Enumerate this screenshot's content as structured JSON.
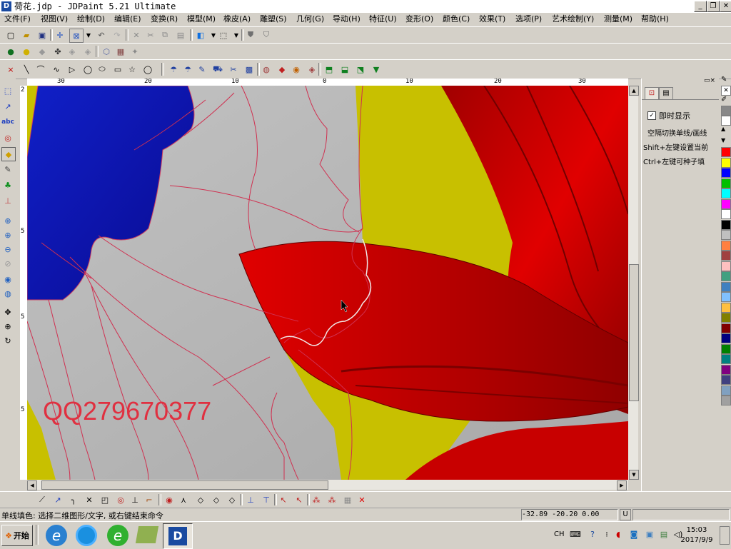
{
  "window": {
    "title": "荷花.jdp - JDPaint 5.21 Ultimate",
    "minimize_label": "_",
    "restore_label": "❐",
    "close_label": "✕"
  },
  "menu": [
    "文件(F)",
    "视图(V)",
    "绘制(D)",
    "编辑(E)",
    "变换(R)",
    "模型(M)",
    "橡皮(A)",
    "雕塑(S)",
    "几何(G)",
    "导动(H)",
    "特征(U)",
    "变形(O)",
    "颜色(C)",
    "效果(T)",
    "选项(P)",
    "艺术绘制(Y)",
    "测量(M)",
    "帮助(H)"
  ],
  "rulers": {
    "top": [
      "30",
      "20",
      "10",
      "0",
      "10",
      "20",
      "30"
    ],
    "left": [
      "2",
      "5",
      "5",
      "5"
    ]
  },
  "canvas": {
    "watermark": "QQ279670377"
  },
  "panel": {
    "checkbox_label": "即时显示",
    "checkbox_checked": true,
    "hint_lines": [
      "空隔切换单线/画线",
      "Shift+左键设置当前",
      "Ctrl+左键可种子填"
    ]
  },
  "palette_colors": [
    "#ff0000",
    "#ffff00",
    "#0000ff",
    "#00c000",
    "#00ffff",
    "#ff00ff",
    "#ffffff",
    "#000000",
    "#c0c0c0",
    "#ff8040",
    "#a04040",
    "#ffc0c0",
    "#40a080",
    "#4080c0",
    "#80c0ff",
    "#ffc040",
    "#808000",
    "#800000",
    "#000080",
    "#008000",
    "#008080",
    "#800080",
    "#404080",
    "#80a0c0",
    "#a0a0a0"
  ],
  "status": {
    "message": "单线填色: 选择二维图形/文字, 或右键结束命令",
    "coords": "-32.89 -20.20 0.00",
    "mode": "U"
  },
  "taskbar": {
    "start_label": "开始",
    "lang": "CH",
    "time": "15:03",
    "date": "2017/9/9"
  },
  "colors": {
    "petal_red": "#d40000",
    "leaf_blue": "#0a14b0",
    "background_yellow": "#c8c000",
    "canvas_gray": "#b4b4b4",
    "watermark": "#e03040"
  }
}
